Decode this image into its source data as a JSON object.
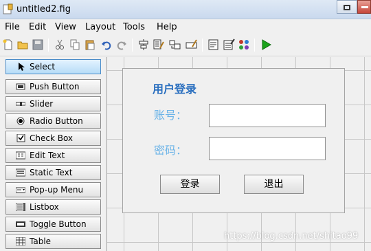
{
  "window": {
    "title": "untitled2.fig"
  },
  "menu": {
    "items": [
      "File",
      "Edit",
      "View",
      "Layout",
      "Tools",
      "Help"
    ]
  },
  "toolbar": {
    "buttons": [
      "new-file-icon",
      "open-folder-icon",
      "save-icon",
      "cut-icon",
      "copy-icon",
      "paste-icon",
      "undo-icon",
      "redo-icon",
      "align-objects-icon",
      "menu-editor-icon",
      "tab-order-editor-icon",
      "toolbar-editor-icon",
      "editor-icon",
      "property-inspector-icon",
      "object-browser-icon",
      "run-figure-icon"
    ]
  },
  "palette": {
    "items": [
      {
        "label": "Select",
        "icon": "pointer-arrow-icon",
        "selected": true
      },
      {
        "label": "Push Button",
        "icon": "push-button-icon"
      },
      {
        "label": "Slider",
        "icon": "slider-icon"
      },
      {
        "label": "Radio Button",
        "icon": "radio-button-icon"
      },
      {
        "label": "Check Box",
        "icon": "check-box-icon"
      },
      {
        "label": "Edit Text",
        "icon": "edit-text-icon"
      },
      {
        "label": "Static Text",
        "icon": "static-text-icon"
      },
      {
        "label": "Pop-up Menu",
        "icon": "popup-menu-icon"
      },
      {
        "label": "Listbox",
        "icon": "listbox-icon"
      },
      {
        "label": "Toggle Button",
        "icon": "toggle-button-icon"
      },
      {
        "label": "Table",
        "icon": "table-icon"
      }
    ]
  },
  "figure": {
    "title": "用户登录",
    "account_label": "账号：",
    "password_label": "密码：",
    "account_value": "",
    "password_value": "",
    "login_button": "登录",
    "exit_button": "退出"
  },
  "watermark": "https://blog.csdn.net/shitao99",
  "colors": {
    "title": "#2a6fbf",
    "label": "#6cb4e8",
    "run": "#1aa31a",
    "selected": "#b6dcf7"
  }
}
